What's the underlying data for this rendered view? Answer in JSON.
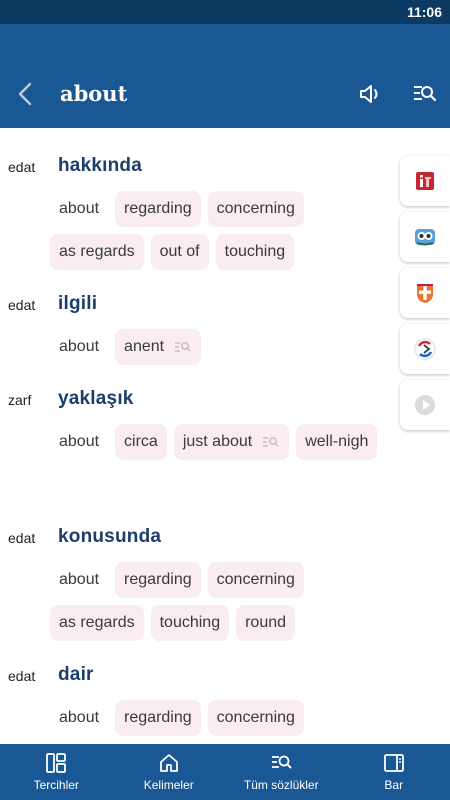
{
  "status": {
    "time": "11:06"
  },
  "header": {
    "title": "about",
    "back_icon": "back-arrow-icon",
    "speaker_icon": "speaker-icon",
    "search_icon": "search-list-icon"
  },
  "entries": [
    {
      "pos": "edat",
      "word": "hakkında",
      "chips": [
        "about",
        "regarding",
        "concerning",
        "as regards",
        "out of",
        "touching"
      ]
    },
    {
      "pos": "edat",
      "word": "ilgili",
      "chips": [
        "about",
        "anent"
      ]
    },
    {
      "pos": "zarf",
      "word": "yaklaşık",
      "chips": [
        "about",
        "circa",
        "just about",
        "well-nigh"
      ]
    },
    {
      "pos": "edat",
      "word": "konusunda",
      "chips": [
        "about",
        "regarding",
        "concerning",
        "as regards",
        "touching",
        "round"
      ]
    },
    {
      "pos": "edat",
      "word": "dair",
      "chips": [
        "about",
        "regarding",
        "concerning"
      ]
    }
  ],
  "side_icons": [
    "red-dictionary-icon",
    "owl-dictionary-icon",
    "cross-shield-icon",
    "recycle-circle-icon",
    "play-icon"
  ],
  "bottom_nav": [
    {
      "label": "Tercihler",
      "icon": "preferences-icon"
    },
    {
      "label": "Kelimeler",
      "icon": "home-icon"
    },
    {
      "label": "Tüm sözlükler",
      "icon": "search-list-icon"
    },
    {
      "label": "Bar",
      "icon": "sidebar-panel-icon"
    }
  ],
  "colors": {
    "appbar": "#1a5895",
    "statusbar": "#0d3a63",
    "chip": "#f9edf0",
    "headword": "#1b3e6b"
  }
}
